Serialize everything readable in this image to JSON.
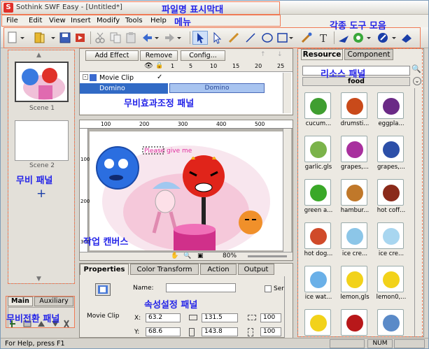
{
  "window": {
    "title": "Sothink SWF Easy - [Untitled*]"
  },
  "menu": [
    "File",
    "Edit",
    "View",
    "Insert",
    "Modify",
    "Tools",
    "Help"
  ],
  "annotations": {
    "title_bar": "파일명 표시막대",
    "menu": "메뉴",
    "toolbars": "각종 도구 모음",
    "resource_panel": "리소스 패널",
    "effect_panel": "무비효과조정 패널",
    "movie_panel": "무비 패널",
    "work_canvas": "작업 캔버스",
    "properties_panel": "속성설정 패널",
    "movie_switch_panel": "무비전환 패널"
  },
  "scenes": [
    {
      "label": "Scene 1"
    },
    {
      "label": "Scene 2"
    }
  ],
  "scene_tabs": {
    "main": "Main",
    "auxiliary": "Auxiliary"
  },
  "effect": {
    "add_effect": "Add Effect",
    "remove": "Remove",
    "config": "Config...",
    "ruler": [
      "1",
      "5",
      "10",
      "15",
      "20",
      "25"
    ],
    "rows": [
      {
        "label": "Movie Clip"
      },
      {
        "label": "Domino"
      }
    ],
    "bar_label": "Domino"
  },
  "canvas": {
    "zoom": "80%",
    "text": "Please give me",
    "ruler_top": [
      "100",
      "200",
      "300",
      "400",
      "500"
    ],
    "ruler_left": [
      "100",
      "200",
      "300"
    ]
  },
  "properties": {
    "tabs": [
      "Properties",
      "Color Transform",
      "Action",
      "Output"
    ],
    "name_label": "Name:",
    "checkbox_label": "Ser",
    "type_label": "Movie Clip",
    "x_label": "X:",
    "x_value": "63.2",
    "y_label": "Y:",
    "y_value": "68.6",
    "w_value": "131.5",
    "h_value": "143.8",
    "sx_value": "100",
    "sy_value": "100"
  },
  "resource": {
    "tabs": [
      "Resource",
      "Component"
    ],
    "category": "food",
    "items": [
      {
        "label": "cucum...",
        "color": "#3f9e30"
      },
      {
        "label": "drumsti...",
        "color": "#c94a1a"
      },
      {
        "label": "eggpla...",
        "color": "#6a2a86"
      },
      {
        "label": "garlic.gls",
        "color": "#7bb34a"
      },
      {
        "label": "grapes,...",
        "color": "#a8309e"
      },
      {
        "label": "grapes,...",
        "color": "#2c4fa8"
      },
      {
        "label": "green a...",
        "color": "#3aa828"
      },
      {
        "label": "hambur...",
        "color": "#c0782a"
      },
      {
        "label": "hot coff...",
        "color": "#8a2a1a"
      },
      {
        "label": "hot dog...",
        "color": "#d04a2a"
      },
      {
        "label": "ice cre...",
        "color": "#8cc6e8"
      },
      {
        "label": "ice cre...",
        "color": "#a8d6f0"
      },
      {
        "label": "ice wat...",
        "color": "#6ab0e8"
      },
      {
        "label": "lemon,gls",
        "color": "#f2d21a"
      },
      {
        "label": "lemon0,...",
        "color": "#f2d21a"
      },
      {
        "label": "",
        "color": "#f2d21a"
      },
      {
        "label": "",
        "color": "#b8181a"
      },
      {
        "label": "",
        "color": "#5a8ac8"
      }
    ]
  },
  "status": {
    "left": "For Help, press F1",
    "num": "NUM"
  }
}
